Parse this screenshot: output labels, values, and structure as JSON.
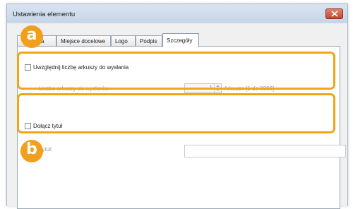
{
  "window": {
    "title": "Ustawienia elementu"
  },
  "tabs": [
    {
      "label": "ca"
    },
    {
      "label": "Miejsce docelowe"
    },
    {
      "label": "Logo"
    },
    {
      "label": "Podpis"
    },
    {
      "label": "Szczegóły"
    }
  ],
  "details": {
    "count_checkbox_label": "Uwzględnij liczbę arkuszy do wysłania",
    "count_field_label": "Liczba arkuszy do wysłania:",
    "count_value": "1",
    "count_unit": "Arkusze [1 do 9999]",
    "title_checkbox_label": "Dołącz tytuł",
    "title_field_label": "Tytuł:",
    "title_value": ""
  },
  "callouts": {
    "a": "a",
    "b": "b"
  },
  "colors": {
    "highlight": "#f3a419",
    "badge": "#f0a01c",
    "close_button": "#c64631"
  }
}
